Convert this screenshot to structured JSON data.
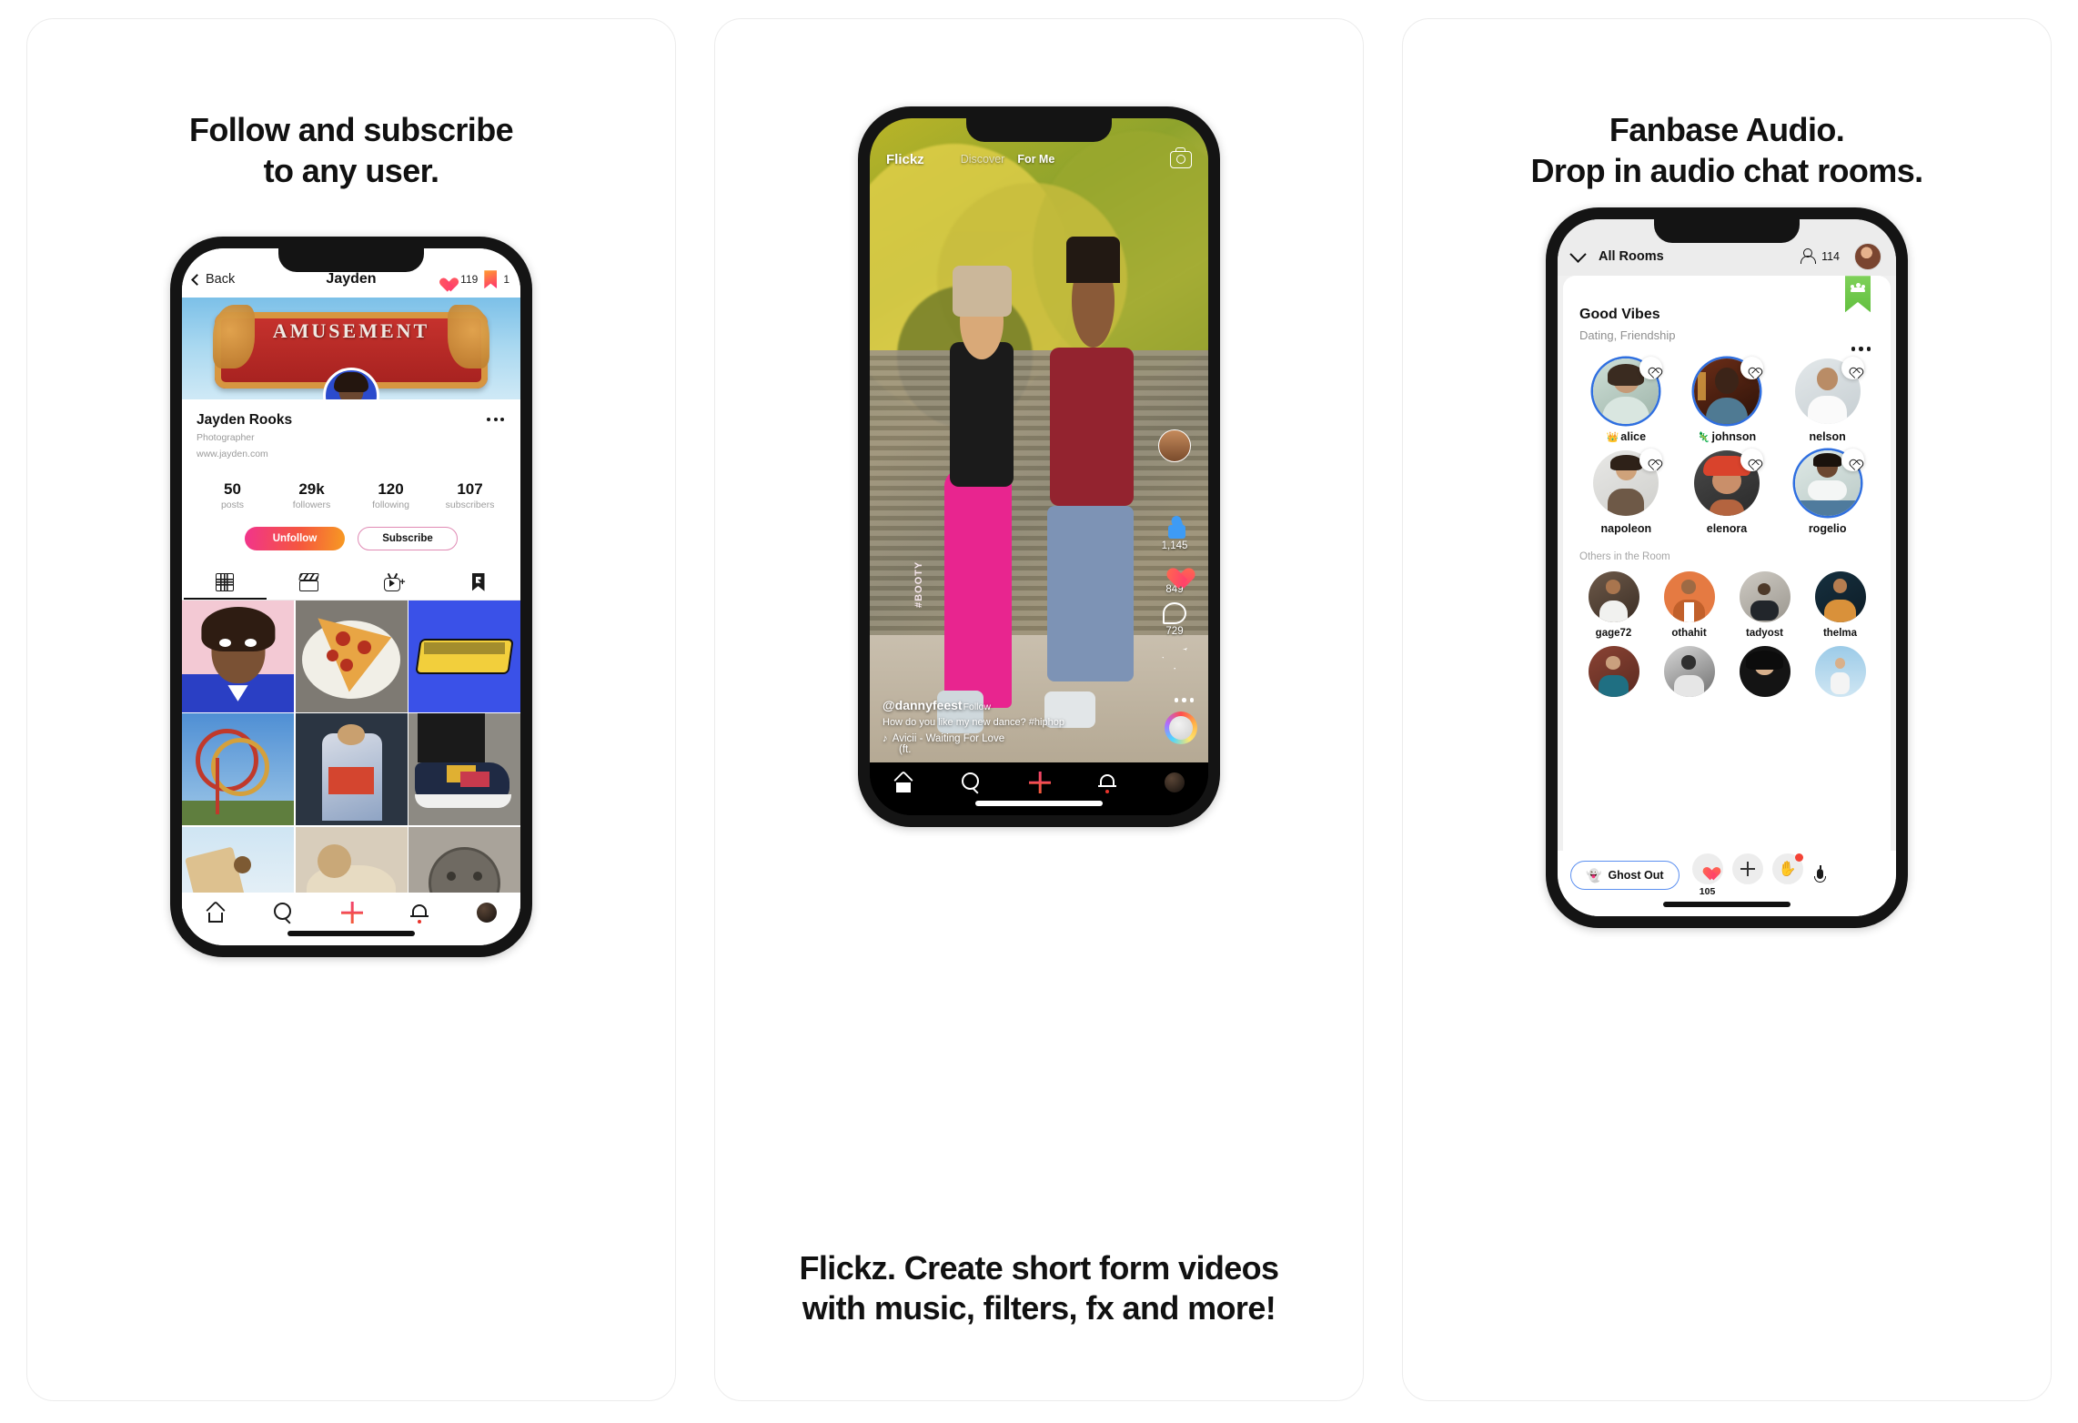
{
  "panels": [
    {
      "heading_line1": "Follow and subscribe",
      "heading_line2": "to any user."
    },
    {
      "caption_line1": "Flickz. Create short form videos",
      "caption_line2": "with music, filters, fx and more!"
    },
    {
      "heading_line1": "Fanbase Audio.",
      "heading_line2": "Drop in audio chat rooms."
    }
  ],
  "profile_screen": {
    "back_label": "Back",
    "title": "Jayden",
    "likes_count": "119",
    "bookmarks_count": "1",
    "cover_sign_text": "AMUSEMENT",
    "name": "Jayden Rooks",
    "occupation": "Photographer",
    "website": "www.jayden.com",
    "stats": [
      {
        "num": "50",
        "label": "posts"
      },
      {
        "num": "29k",
        "label": "followers"
      },
      {
        "num": "120",
        "label": "following"
      },
      {
        "num": "107",
        "label": "subscribers"
      }
    ],
    "unfollow_label": "Unfollow",
    "subscribe_label": "Subscribe",
    "tabs": [
      {
        "icon": "grid-icon",
        "active": true
      },
      {
        "icon": "clapperboard-icon",
        "active": false
      },
      {
        "icon": "tv-plus-icon",
        "active": false
      },
      {
        "icon": "bookmark-icon",
        "active": false
      }
    ],
    "grid_cells": [
      {
        "name": "portrait-pink",
        "desc": "Portrait of young person on pink background"
      },
      {
        "name": "pizza-slice",
        "desc": "Pepperoni pizza slice on paper plate"
      },
      {
        "name": "atlanta-graffiti",
        "desc": "Atlanta graffiti lettering on blue"
      },
      {
        "name": "roller-coaster",
        "desc": "Red roller coaster loops against blue sky"
      },
      {
        "name": "street-performer",
        "desc": "Person in colorful jacket on street"
      },
      {
        "name": "sneaker",
        "desc": "Colorful sneaker on pavement"
      },
      {
        "name": "snow-scene",
        "desc": "Snowy scene"
      },
      {
        "name": "pastry",
        "desc": "Pastries close-up"
      },
      {
        "name": "manhole-cover",
        "desc": "Manhole cover on sidewalk"
      }
    ],
    "bottom_nav": [
      "home-icon",
      "search-icon",
      "plus-icon",
      "bell-icon",
      "avatar-icon"
    ]
  },
  "video_screen": {
    "logo": "Flickz",
    "tabs": [
      {
        "label": "Discover",
        "active": false
      },
      {
        "label": "For Me",
        "active": true
      }
    ],
    "camera_icon": "camera-icon",
    "rail": {
      "thumbs_up_count": "1,145",
      "likes_count": "849",
      "comments_count": "729",
      "share_icon": "send-icon"
    },
    "username": "@dannyfeest",
    "follow_label": "Follow",
    "description": "How do you like my new dance? #hiphop",
    "music_line1": "Avicii - Waiting For Love",
    "music_line2": "(ft.",
    "bottom_nav": [
      "home-icon",
      "search-icon",
      "plus-icon",
      "bell-icon",
      "avatar-icon"
    ]
  },
  "audio_screen": {
    "rooms_label": "All Rooms",
    "people_count": "114",
    "room_title": "Good Vibes",
    "room_tags": "Dating, Friendship",
    "speakers": [
      {
        "badge": "👑",
        "name": "alice",
        "ring": true
      },
      {
        "badge": "🦎",
        "name": "johnson",
        "ring": true
      },
      {
        "badge": "",
        "name": "nelson",
        "ring": false
      },
      {
        "badge": "",
        "name": "napoleon",
        "ring": false
      },
      {
        "badge": "",
        "name": "elenora",
        "ring": false
      },
      {
        "badge": "",
        "name": "rogelio",
        "ring": true
      }
    ],
    "others_label": "Others in the Room",
    "others": [
      {
        "name": "gage72"
      },
      {
        "name": "othahit"
      },
      {
        "name": "tadyost"
      },
      {
        "name": "thelma"
      }
    ],
    "others_extra_rows": 4,
    "ghost_button_label": "Ghost Out",
    "ghost_emoji": "👻",
    "react_count": "105",
    "hand_emoji": "✋",
    "mic_icon": "microphone-icon"
  }
}
